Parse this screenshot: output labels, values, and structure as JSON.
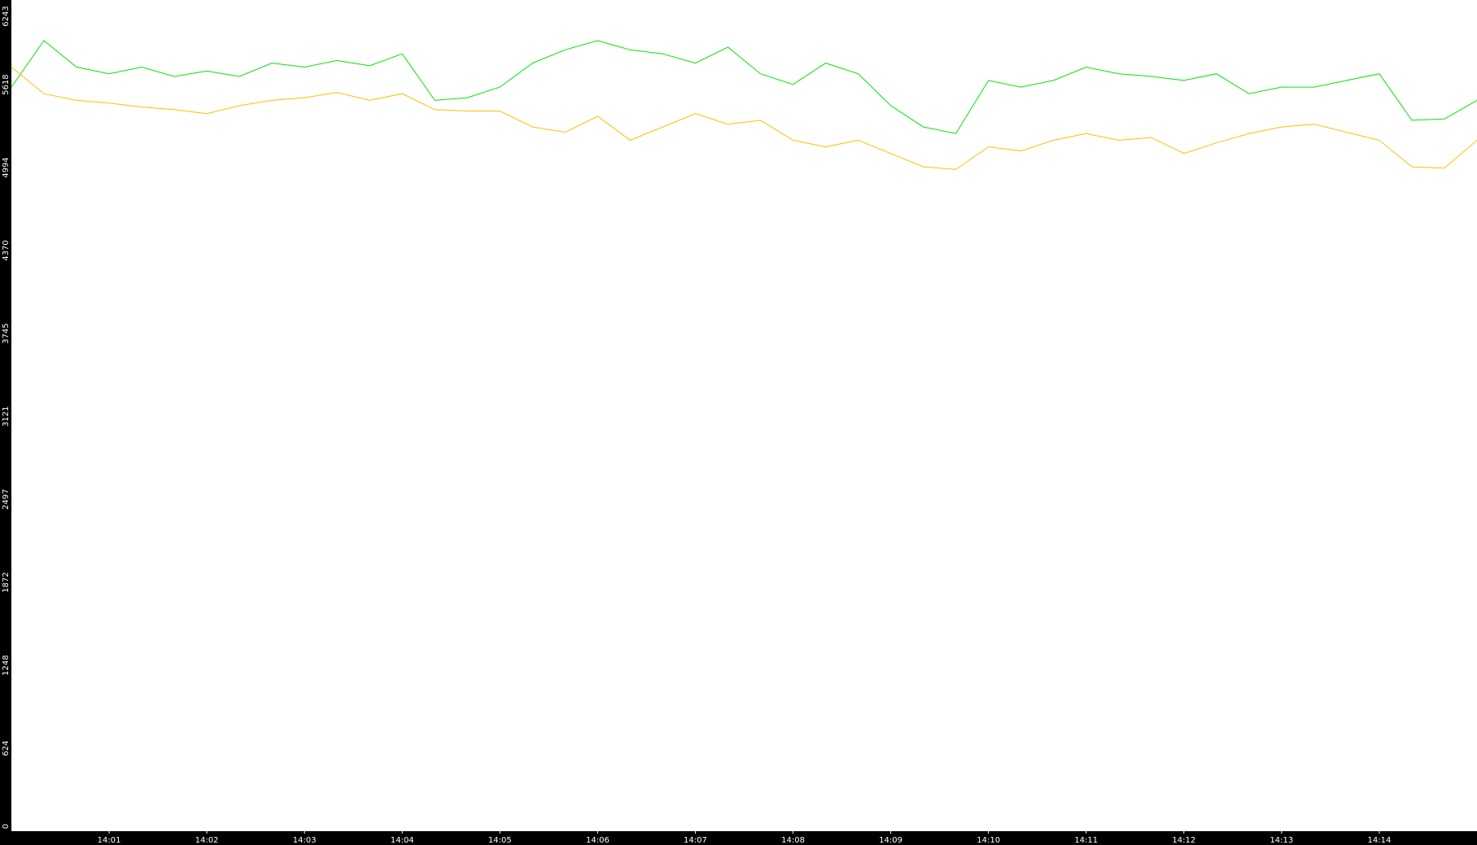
{
  "chart_data": {
    "type": "line",
    "title": "",
    "xlabel": "",
    "ylabel": "",
    "ylim": [
      0,
      6243
    ],
    "y_ticks": [
      "0",
      "624",
      "1248",
      "1872",
      "2497",
      "3121",
      "3745",
      "4370",
      "4994",
      "5618",
      "6243"
    ],
    "x_tick_labels": [
      "14:01",
      "14:02",
      "14:03",
      "14:04",
      "14:05",
      "14:06",
      "14:07",
      "14:08",
      "14:09",
      "14:10",
      "14:11",
      "14:12",
      "14:13",
      "14:14"
    ],
    "x_range": [
      "14:00",
      "14:15"
    ],
    "grid": false,
    "legend": "none",
    "colors": {
      "background": "#000000",
      "plot_area": "#ffffff",
      "text": "#ffffff",
      "green": "#00e600",
      "yellow": "#ffbf00"
    },
    "series": [
      {
        "color": "green",
        "x": [
          "14:00:00",
          "14:00:20",
          "14:00:40",
          "14:01:00",
          "14:01:20",
          "14:01:40",
          "14:02:00",
          "14:02:20",
          "14:02:40",
          "14:03:00",
          "14:03:20",
          "14:03:40",
          "14:04:00",
          "14:04:20",
          "14:04:40",
          "14:05:00",
          "14:05:20",
          "14:05:40",
          "14:06:00",
          "14:06:20",
          "14:06:40",
          "14:07:00",
          "14:07:20",
          "14:07:40",
          "14:08:00",
          "14:08:20",
          "14:08:40",
          "14:09:00",
          "14:09:20",
          "14:09:40",
          "14:10:00",
          "14:10:20",
          "14:10:40",
          "14:11:00",
          "14:11:20",
          "14:11:40",
          "14:12:00",
          "14:12:20",
          "14:12:40",
          "14:13:00",
          "14:13:20",
          "14:13:40",
          "14:14:00",
          "14:14:20",
          "14:14:40",
          "14:15:00"
        ],
        "values": [
          5600,
          5950,
          5750,
          5700,
          5750,
          5680,
          5720,
          5680,
          5780,
          5750,
          5800,
          5760,
          5850,
          5500,
          5520,
          5600,
          5780,
          5880,
          5950,
          5880,
          5850,
          5780,
          5900,
          5700,
          5620,
          5780,
          5700,
          5460,
          5300,
          5250,
          5650,
          5600,
          5650,
          5750,
          5700,
          5680,
          5650,
          5700,
          5550,
          5600,
          5600,
          5650,
          5700,
          5350,
          5360,
          5500
        ]
      },
      {
        "color": "yellow",
        "x": [
          "14:00:00",
          "14:00:20",
          "14:00:40",
          "14:01:00",
          "14:01:20",
          "14:01:40",
          "14:02:00",
          "14:02:20",
          "14:02:40",
          "14:03:00",
          "14:03:20",
          "14:03:40",
          "14:04:00",
          "14:04:20",
          "14:04:40",
          "14:05:00",
          "14:05:20",
          "14:05:40",
          "14:06:00",
          "14:06:20",
          "14:06:40",
          "14:07:00",
          "14:07:20",
          "14:07:40",
          "14:08:00",
          "14:08:20",
          "14:08:40",
          "14:09:00",
          "14:09:20",
          "14:09:40",
          "14:10:00",
          "14:10:20",
          "14:10:40",
          "14:11:00",
          "14:11:20",
          "14:11:40",
          "14:12:00",
          "14:12:20",
          "14:12:40",
          "14:13:00",
          "14:13:20",
          "14:13:40",
          "14:14:00",
          "14:14:20",
          "14:14:40",
          "14:15:00"
        ],
        "values": [
          5750,
          5550,
          5500,
          5480,
          5450,
          5430,
          5400,
          5460,
          5500,
          5520,
          5560,
          5500,
          5550,
          5430,
          5420,
          5420,
          5300,
          5260,
          5380,
          5200,
          5300,
          5400,
          5320,
          5350,
          5200,
          5150,
          5200,
          5100,
          5000,
          4980,
          5150,
          5120,
          5200,
          5250,
          5200,
          5220,
          5100,
          5180,
          5250,
          5300,
          5320,
          5260,
          5200,
          5000,
          4990,
          5200
        ]
      }
    ]
  }
}
